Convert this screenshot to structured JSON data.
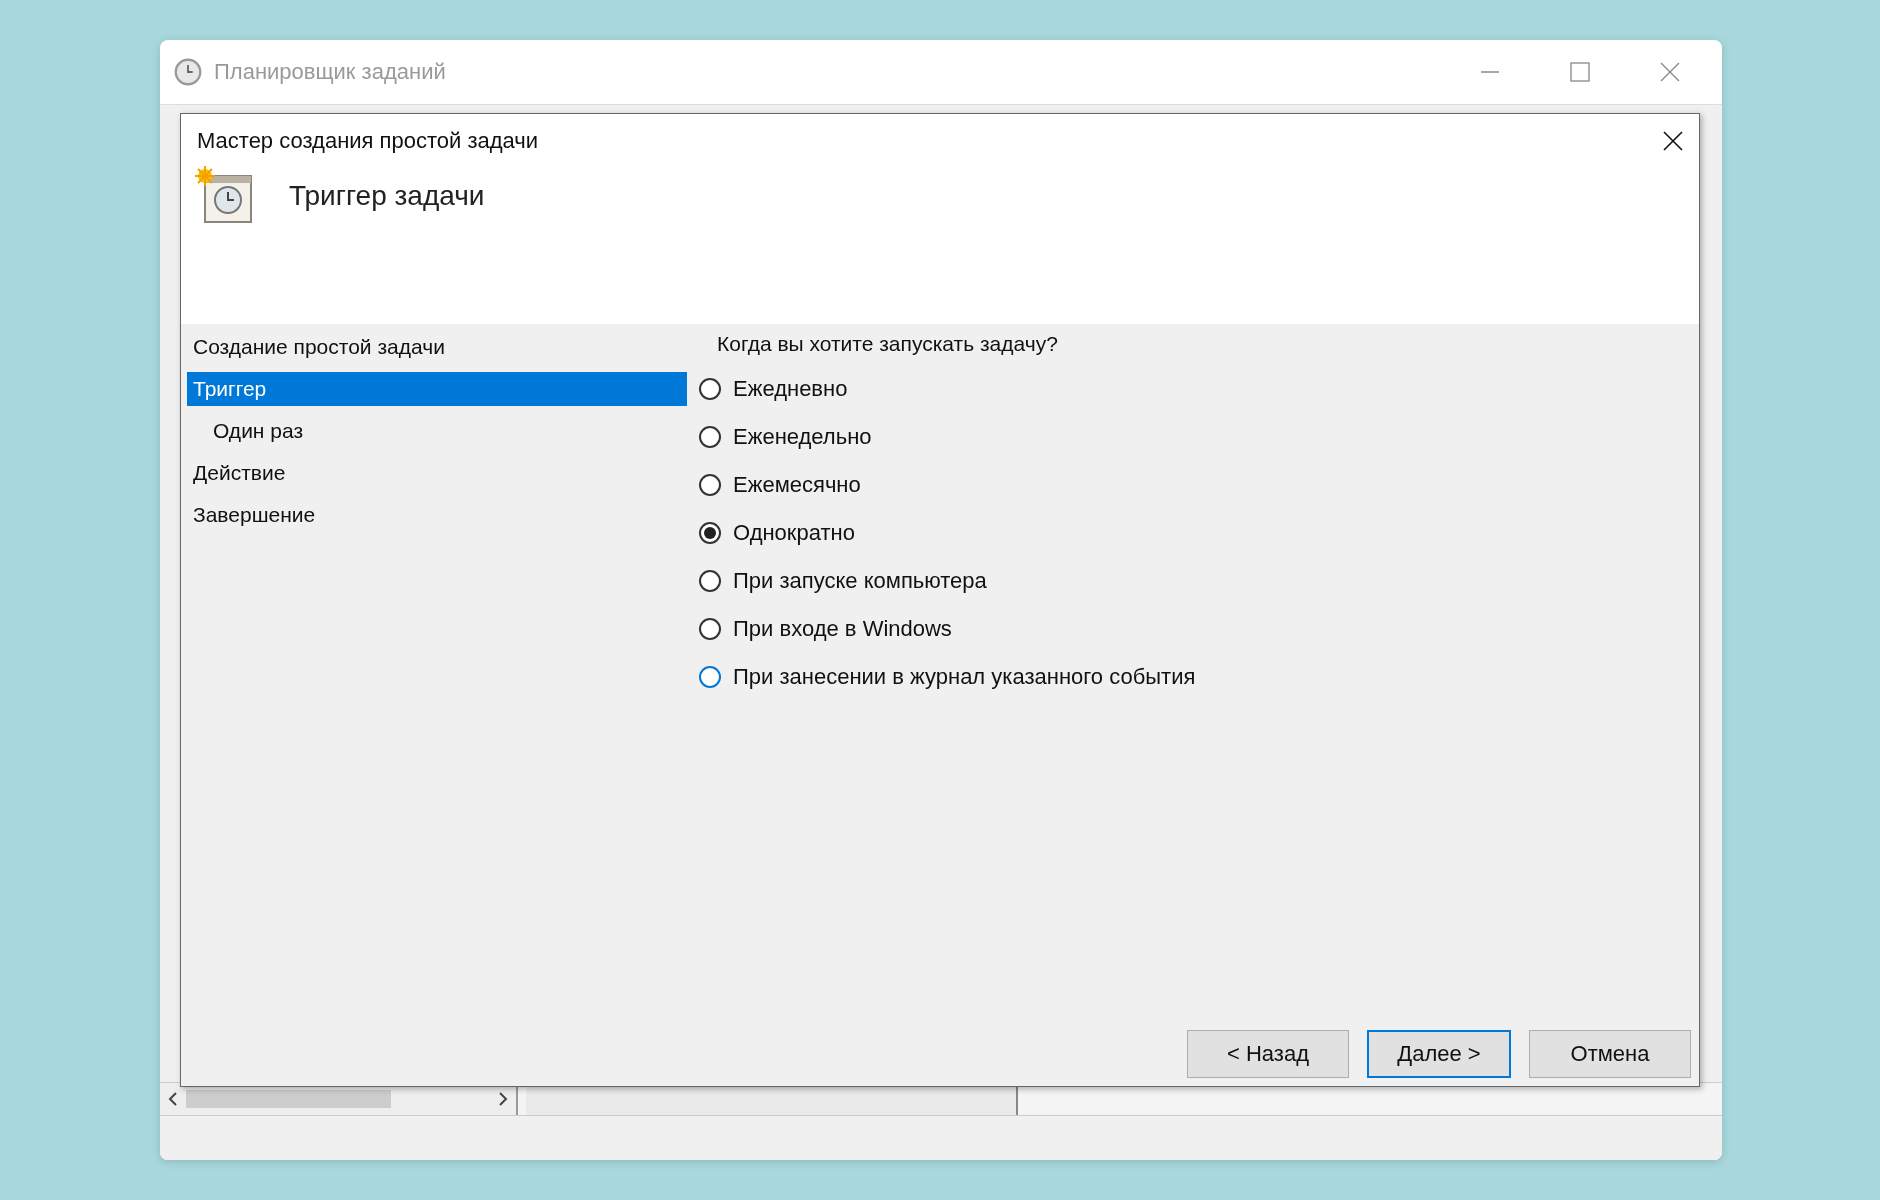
{
  "window": {
    "title": "Планировщик заданий"
  },
  "dialog": {
    "title": "Мастер создания простой задачи",
    "heading": "Триггер задачи"
  },
  "steps": [
    {
      "label": "Создание простой задачи",
      "selected": false
    },
    {
      "label": "Триггер",
      "selected": true,
      "children": [
        {
          "label": "Один раз",
          "selected": false
        }
      ]
    },
    {
      "label": "Действие",
      "selected": false
    },
    {
      "label": "Завершение",
      "selected": false
    }
  ],
  "question": "Когда вы хотите запускать задачу?",
  "options": [
    {
      "label": "Ежедневно",
      "selected": false,
      "focused": false
    },
    {
      "label": "Еженедельно",
      "selected": false,
      "focused": false
    },
    {
      "label": "Ежемесячно",
      "selected": false,
      "focused": false
    },
    {
      "label": "Однократно",
      "selected": true,
      "focused": false
    },
    {
      "label": "При запуске компьютера",
      "selected": false,
      "focused": false
    },
    {
      "label": "При входе в Windows",
      "selected": false,
      "focused": false
    },
    {
      "label": "При занесении в журнал указанного события",
      "selected": false,
      "focused": true
    }
  ],
  "buttons": [
    {
      "label": "< Назад",
      "kind": "normal"
    },
    {
      "label": "Далее >",
      "kind": "default"
    },
    {
      "label": "Отмена",
      "kind": "normal"
    }
  ]
}
